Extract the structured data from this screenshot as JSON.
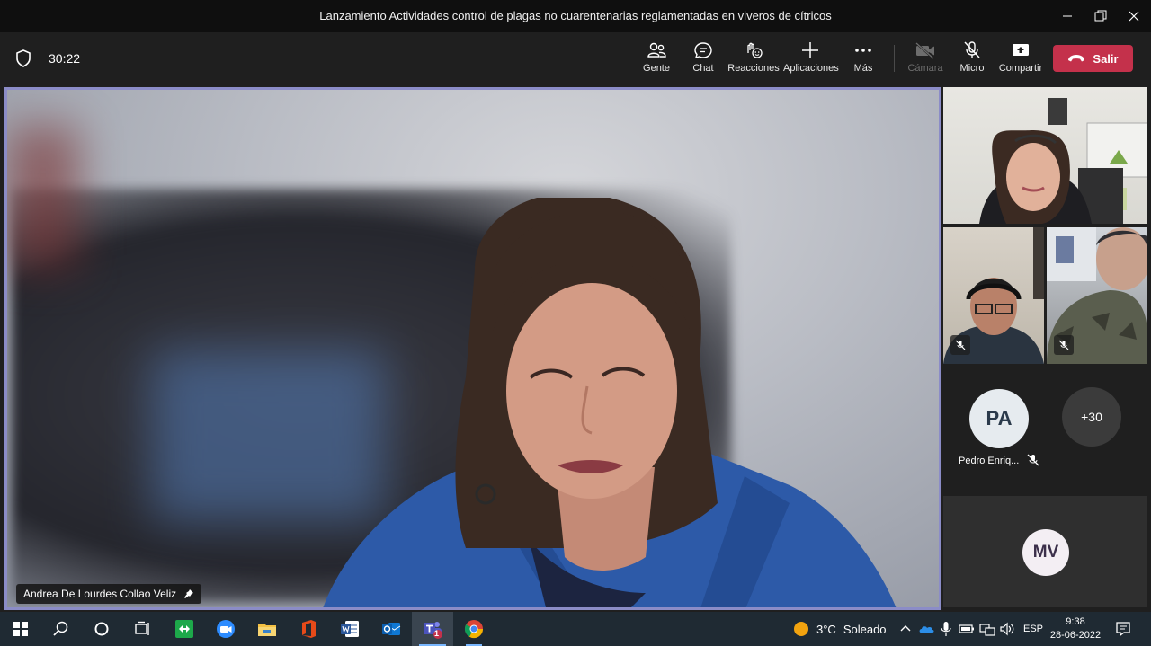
{
  "window": {
    "title": "Lanzamiento Actividades control de plagas no cuarentenarias reglamentadas en viveros de cítricos"
  },
  "meeting": {
    "timer": "30:22",
    "toolbar": {
      "people": "Gente",
      "chat": "Chat",
      "reactions": "Reacciones",
      "apps": "Aplicaciones",
      "more": "Más",
      "camera": "Cámara",
      "mic": "Micro",
      "share": "Compartir",
      "leave": "Salir"
    }
  },
  "main_video": {
    "participant_name": "Andrea De Lourdes Collao Veliz",
    "pinned": true
  },
  "side_panel": {
    "avatar_pa_initials": "PA",
    "avatar_pa_name": "Pedro Enriq...",
    "overflow_count": "+30",
    "avatar_mv_initials": "MV"
  },
  "taskbar": {
    "weather_temp": "3°C",
    "weather_condition": "Soleado",
    "language": "ESP",
    "time": "9:38",
    "date": "28-06-2022",
    "teams_badge": "1"
  },
  "colors": {
    "leave": "#c4314b",
    "active_speaker_border": "#8b8cc7"
  }
}
